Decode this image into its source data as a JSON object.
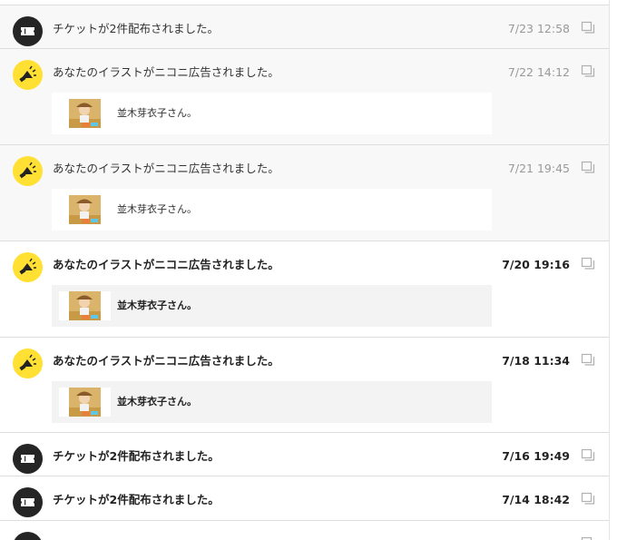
{
  "notifications": [
    {
      "type": "ticket",
      "state": "read",
      "message": "チケットが2件配布されました。",
      "time": "7/23 12:58"
    },
    {
      "type": "ad",
      "state": "read",
      "message": "あなたのイラストがニコニ広告されました。",
      "time": "7/22 14:12",
      "card": {
        "text": "並木芽衣子さん。"
      }
    },
    {
      "type": "ad",
      "state": "read",
      "message": "あなたのイラストがニコニ広告されました。",
      "time": "7/21 19:45",
      "card": {
        "text": "並木芽衣子さん。"
      }
    },
    {
      "type": "ad",
      "state": "unread",
      "message": "あなたのイラストがニコニ広告されました。",
      "time": "7/20 19:16",
      "card": {
        "text": "並木芽衣子さん。"
      }
    },
    {
      "type": "ad",
      "state": "unread",
      "message": "あなたのイラストがニコニ広告されました。",
      "time": "7/18 11:34",
      "card": {
        "text": "並木芽衣子さん。"
      }
    },
    {
      "type": "ticket",
      "state": "unread",
      "message": "チケットが2件配布されました。",
      "time": "7/16 19:49"
    },
    {
      "type": "ticket",
      "state": "unread",
      "message": "チケットが2件配布されました。",
      "time": "7/14 18:42"
    },
    {
      "type": "ticket",
      "state": "unread",
      "message": "",
      "time": ""
    }
  ],
  "icons": {
    "ticket": "ticket-icon",
    "ad": "megaphone-icon",
    "copy": "copy-icon",
    "thumbnail": "illustration-thumbnail"
  },
  "colors": {
    "ticket_avatar": "#252525",
    "ad_avatar": "#ffe033",
    "read_background": "#f8f8f8",
    "divider": "#dddddd"
  }
}
